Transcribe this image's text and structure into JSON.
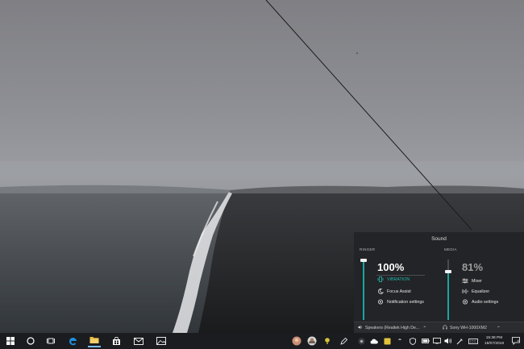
{
  "flyout": {
    "title": "Sound",
    "ringer": {
      "label": "RINGER",
      "percent": "100%",
      "level": 1.0,
      "items": [
        "VIBRATION",
        "Focus Assist",
        "Notification settings"
      ]
    },
    "media": {
      "label": "MEDIA",
      "percent": "81%",
      "level": 0.81,
      "items": [
        "Mixer",
        "Equalizer",
        "Audio settings"
      ]
    },
    "devices": {
      "left": "Speakers (Realtek High De...",
      "right": "Sony WH-1000XM2"
    }
  },
  "taskbar": {
    "time": "15:38 PM",
    "date": "18/07/2018"
  },
  "colors": {
    "accent": "#19a7a0",
    "flyout_bg": "#232427",
    "taskbar_bg": "#1b1c1f"
  }
}
